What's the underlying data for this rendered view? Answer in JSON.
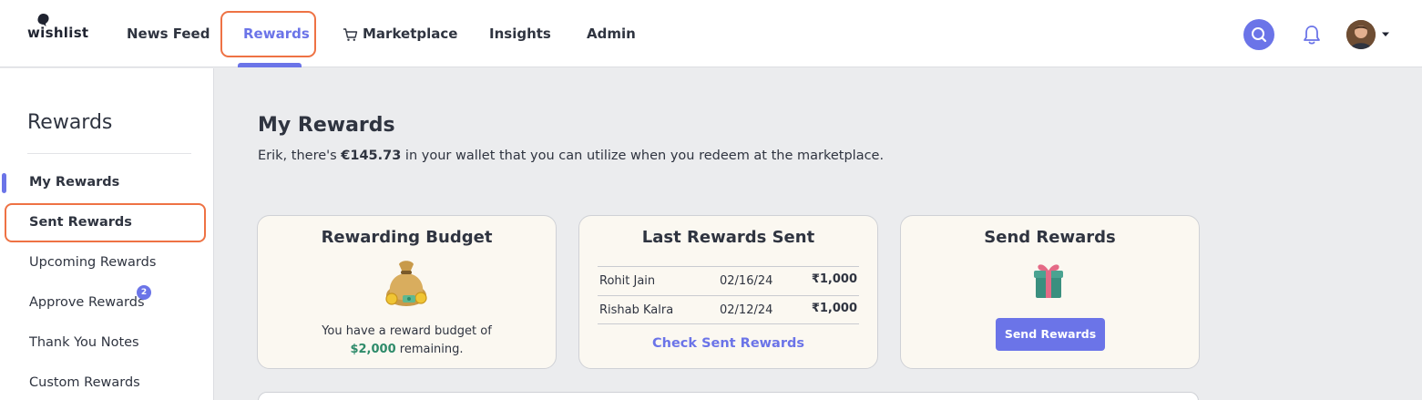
{
  "header": {
    "logo_text": "wishlist",
    "nav": [
      {
        "label": "News Feed"
      },
      {
        "label": "Rewards"
      },
      {
        "label": "Marketplace"
      },
      {
        "label": "Insights"
      },
      {
        "label": "Admin"
      }
    ],
    "active_nav": "Rewards",
    "icons": [
      "search-icon",
      "bell-icon",
      "cart-icon",
      "avatar",
      "chevron-down-icon"
    ]
  },
  "sidebar": {
    "title": "Rewards",
    "items": [
      {
        "label": "My Rewards"
      },
      {
        "label": "Sent Rewards"
      },
      {
        "label": "Upcoming Rewards"
      },
      {
        "label": "Approve Rewards",
        "badge": "2"
      },
      {
        "label": "Thank You Notes"
      },
      {
        "label": "Custom Rewards"
      }
    ],
    "active_item": "My Rewards"
  },
  "main": {
    "title": "My Rewards",
    "subtitle_prefix": "Erik, there's ",
    "wallet_amount": "€145.73",
    "subtitle_suffix": " in your wallet that you can utilize when you redeem at the marketplace."
  },
  "cards": {
    "budget": {
      "title": "Rewarding Budget",
      "text_before": "You have a reward budget of",
      "amount": "$2,000",
      "text_after": " remaining."
    },
    "last_sent": {
      "title": "Last Rewards Sent",
      "rows": [
        {
          "name": "Rohit Jain",
          "date": "02/16/24",
          "amount": "₹1,000"
        },
        {
          "name": "Rishab Kalra",
          "date": "02/12/24",
          "amount": "₹1,000"
        }
      ],
      "link_label": "Check Sent Rewards"
    },
    "send": {
      "title": "Send Rewards",
      "button_label": "Send Rewards"
    }
  },
  "colors": {
    "accent": "#6b74e8",
    "highlight": "#ee7244",
    "money_green": "#2e8b6a",
    "card_bg": "#fbf8f1",
    "page_bg": "#ebecee"
  }
}
